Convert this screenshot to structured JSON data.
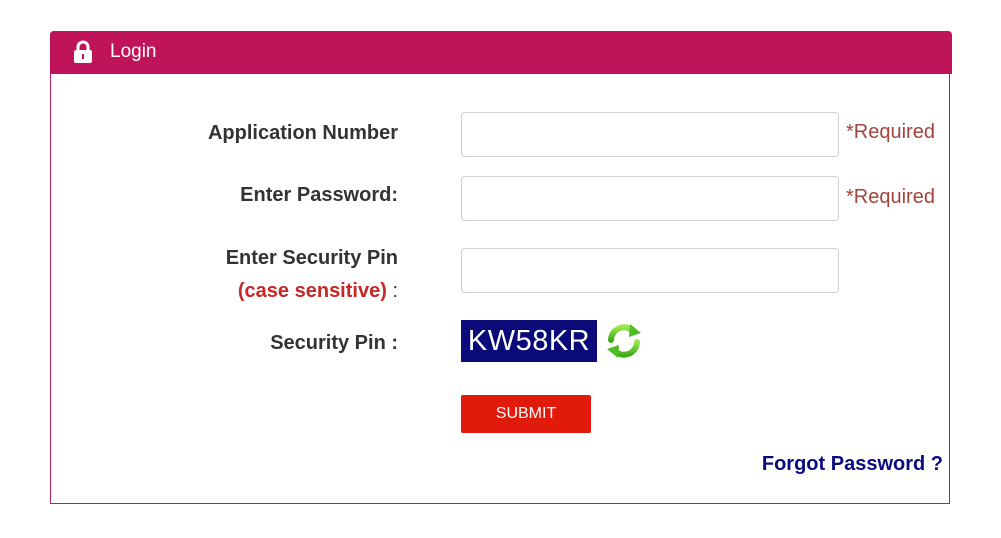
{
  "header": {
    "title": "Login",
    "color": "#c0145a"
  },
  "form": {
    "application_number": {
      "label": "Application Number",
      "value": "",
      "required_text": "*Required"
    },
    "password": {
      "label": "Enter Password:",
      "value": "",
      "required_text": "*Required"
    },
    "security_pin_input": {
      "label": "Enter Security Pin",
      "sub_label": "(case sensitive)",
      "colon": ":",
      "value": ""
    },
    "security_pin_display": {
      "label": "Security Pin :",
      "captcha_text": "KW58KR",
      "captcha_bg": "#0a0a78",
      "refresh_icon": "refresh-icon"
    },
    "submit_label": "SUBMIT",
    "submit_color": "#e21a0c",
    "forgot_password_label": "Forgot Password ?"
  },
  "icons": {
    "header_icon": "lock-icon"
  }
}
